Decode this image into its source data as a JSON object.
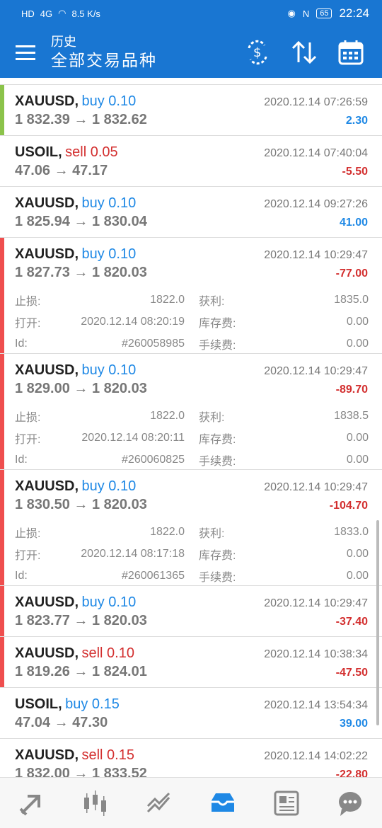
{
  "status_bar": {
    "hd": "HD",
    "signal": "4G",
    "speed": "8.5 K/s",
    "battery": "65",
    "time": "22:24"
  },
  "header": {
    "title": "历史",
    "subtitle": "全部交易品种"
  },
  "icons": {
    "menu": "hamburger-menu-icon",
    "currency": "currency-exchange-icon",
    "sort": "sort-arrows-icon",
    "calendar": "calendar-icon"
  },
  "colors": {
    "primary": "#1976d2",
    "buy": "#1e88e5",
    "sell": "#d32f2f",
    "profit_pos": "#1e88e5",
    "profit_neg": "#d32f2f",
    "bar_green": "#8bc34a",
    "bar_red": "#ef4e4e"
  },
  "labels": {
    "sl": "止损:",
    "tp": "获利:",
    "open": "打开:",
    "swap": "库存费:",
    "id": "Id:",
    "commission": "手续费:"
  },
  "trades": [
    {
      "symbol": "XAUUSD,",
      "side": "buy 0.10",
      "time": "2020.12.14 07:26:59",
      "prices": "1 832.39 → 1 832.62",
      "profit": "2.30"
    },
    {
      "symbol": "USOIL,",
      "side": "sell 0.05",
      "time": "2020.12.14 07:40:04",
      "prices": "47.06 → 47.17",
      "profit": "-5.50"
    },
    {
      "symbol": "XAUUSD,",
      "side": "buy 0.10",
      "time": "2020.12.14 09:27:26",
      "prices": "1 825.94 → 1 830.04",
      "profit": "41.00"
    },
    {
      "symbol": "XAUUSD,",
      "side": "buy 0.10",
      "time": "2020.12.14 10:29:47",
      "prices": "1 827.73 → 1 820.03",
      "profit": "-77.00",
      "sl": "1822.0",
      "tp": "1835.0",
      "open": "2020.12.14 08:20:19",
      "swap": "0.00",
      "id": "#260058985",
      "commission": "0.00"
    },
    {
      "symbol": "XAUUSD,",
      "side": "buy 0.10",
      "time": "2020.12.14 10:29:47",
      "prices": "1 829.00 → 1 820.03",
      "profit": "-89.70",
      "sl": "1822.0",
      "tp": "1838.5",
      "open": "2020.12.14 08:20:11",
      "swap": "0.00",
      "id": "#260060825",
      "commission": "0.00"
    },
    {
      "symbol": "XAUUSD,",
      "side": "buy 0.10",
      "time": "2020.12.14 10:29:47",
      "prices": "1 830.50 → 1 820.03",
      "profit": "-104.70",
      "sl": "1822.0",
      "tp": "1833.0",
      "open": "2020.12.14 08:17:18",
      "swap": "0.00",
      "id": "#260061365",
      "commission": "0.00"
    },
    {
      "symbol": "XAUUSD,",
      "side": "buy 0.10",
      "time": "2020.12.14 10:29:47",
      "prices": "1 823.77 → 1 820.03",
      "profit": "-37.40"
    },
    {
      "symbol": "XAUUSD,",
      "side": "sell 0.10",
      "time": "2020.12.14 10:38:34",
      "prices": "1 819.26 → 1 824.01",
      "profit": "-47.50"
    },
    {
      "symbol": "USOIL,",
      "side": "buy 0.15",
      "time": "2020.12.14 13:54:34",
      "prices": "47.04 → 47.30",
      "profit": "39.00"
    },
    {
      "symbol": "XAUUSD,",
      "side": "sell 0.15",
      "time": "2020.12.14 14:02:22",
      "prices": "1 832.00 → 1 833.52",
      "profit": "-22.80"
    }
  ],
  "bottom_nav": [
    "quotes-icon",
    "chart-candles-icon",
    "trade-icon",
    "history-inbox-icon",
    "news-icon",
    "chat-icon"
  ]
}
